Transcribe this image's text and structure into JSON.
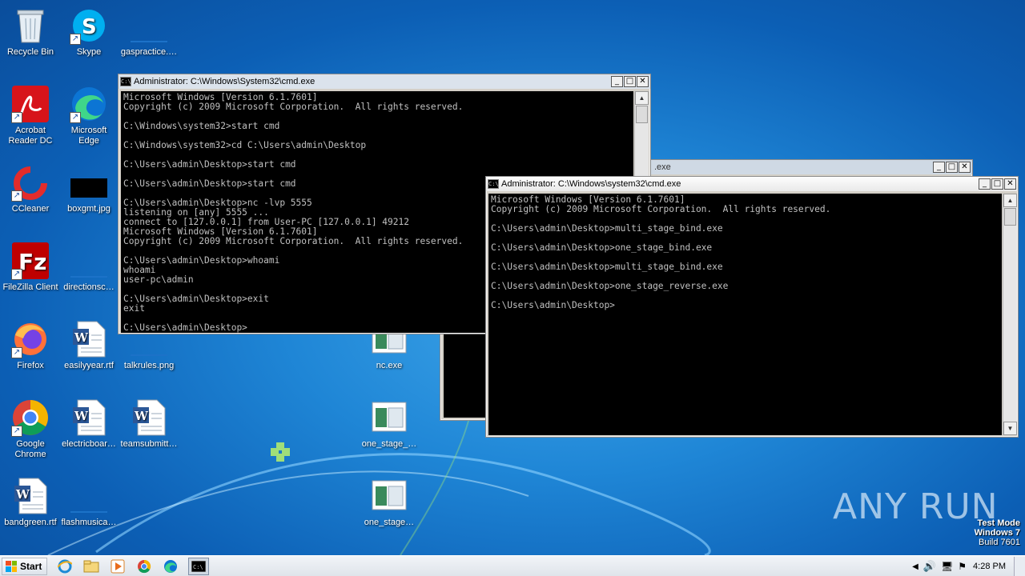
{
  "desktop": {
    "icons": [
      {
        "label": "Recycle Bin",
        "icon": "recycle-bin-icon"
      },
      {
        "label": "Skype",
        "icon": "skype-icon"
      },
      {
        "label": "gaspractice.…",
        "icon": "file-icon"
      },
      {
        "label": "Acrobat Reader DC",
        "icon": "acrobat-icon"
      },
      {
        "label": "Microsoft Edge",
        "icon": "edge-icon"
      },
      {
        "label": "CCleaner",
        "icon": "ccleaner-icon"
      },
      {
        "label": "boxgmt.jpg",
        "icon": "image-file-icon"
      },
      {
        "label": "FileZilla Client",
        "icon": "filezilla-icon"
      },
      {
        "label": "directionsc…",
        "icon": "file-icon"
      },
      {
        "label": "Firefox",
        "icon": "firefox-icon"
      },
      {
        "label": "easilyyear.rtf",
        "icon": "word-doc-icon"
      },
      {
        "label": "talkrules.png",
        "icon": "image-file-icon"
      },
      {
        "label": "nc.exe",
        "icon": "exe-icon"
      },
      {
        "label": "Google Chrome",
        "icon": "chrome-icon"
      },
      {
        "label": "electricboar…",
        "icon": "word-doc-icon"
      },
      {
        "label": "teamsubmitt…",
        "icon": "word-doc-icon"
      },
      {
        "label": "one_stage_…",
        "icon": "exe-icon"
      },
      {
        "label": "bandgreen.rtf",
        "icon": "word-doc-icon"
      },
      {
        "label": "flashmusica…",
        "icon": "file-icon"
      },
      {
        "label": "one_stage…",
        "icon": "exe-icon"
      }
    ]
  },
  "windows": {
    "back": {
      "title": ".exe"
    },
    "left": {
      "title": "Administrator: C:\\Windows\\System32\\cmd.exe",
      "lines": [
        "Microsoft Windows [Version 6.1.7601]",
        "Copyright (c) 2009 Microsoft Corporation.  All rights reserved.",
        "",
        "C:\\Windows\\system32>start cmd",
        "",
        "C:\\Windows\\system32>cd C:\\Users\\admin\\Desktop",
        "",
        "C:\\Users\\admin\\Desktop>start cmd",
        "",
        "C:\\Users\\admin\\Desktop>start cmd",
        "",
        "C:\\Users\\admin\\Desktop>nc -lvp 5555",
        "listening on [any] 5555 ...",
        "connect to [127.0.0.1] from User-PC [127.0.0.1] 49212",
        "Microsoft Windows [Version 6.1.7601]",
        "Copyright (c) 2009 Microsoft Corporation.  All rights reserved.",
        "",
        "C:\\Users\\admin\\Desktop>whoami",
        "whoami",
        "user-pc\\admin",
        "",
        "C:\\Users\\admin\\Desktop>exit",
        "exit",
        "",
        "C:\\Users\\admin\\Desktop>"
      ]
    },
    "right": {
      "title": "Administrator: C:\\Windows\\system32\\cmd.exe",
      "lines": [
        "Microsoft Windows [Version 6.1.7601]",
        "Copyright (c) 2009 Microsoft Corporation.  All rights reserved.",
        "",
        "C:\\Users\\admin\\Desktop>multi_stage_bind.exe",
        "",
        "C:\\Users\\admin\\Desktop>one_stage_bind.exe",
        "",
        "C:\\Users\\admin\\Desktop>multi_stage_bind.exe",
        "",
        "C:\\Users\\admin\\Desktop>one_stage_reverse.exe",
        "",
        "C:\\Users\\admin\\Desktop>"
      ]
    },
    "buttons": {
      "minimize": "_",
      "maximize": "□",
      "close": "✕",
      "scroll_up": "▲",
      "scroll_down": "▼"
    }
  },
  "taskbar": {
    "start_label": "Start",
    "clock": "4:28 PM",
    "pinned": [
      "ie-icon",
      "explorer-icon",
      "media-player-icon",
      "chrome-icon",
      "edge-icon",
      "cmd-icon"
    ]
  },
  "watermark": {
    "brand": "ANY RUN",
    "line1": "Test Mode",
    "line2": "Windows 7",
    "line3": "Build 7601"
  }
}
